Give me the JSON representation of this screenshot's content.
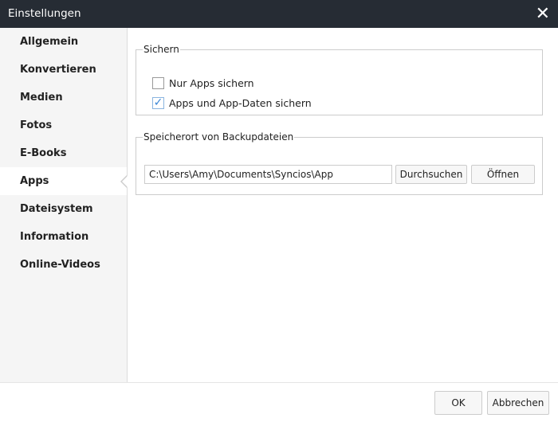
{
  "window": {
    "title": "Einstellungen",
    "close_icon": "close-icon"
  },
  "sidebar": {
    "items": [
      {
        "label": "Allgemein"
      },
      {
        "label": "Konvertieren"
      },
      {
        "label": "Medien"
      },
      {
        "label": "Fotos"
      },
      {
        "label": "E-Books"
      },
      {
        "label": "Apps",
        "selected": true
      },
      {
        "label": "Dateisystem"
      },
      {
        "label": "Information"
      },
      {
        "label": "Online-Videos"
      }
    ]
  },
  "backup": {
    "legend": "Sichern",
    "options": [
      {
        "label": "Nur Apps sichern",
        "checked": false
      },
      {
        "label": "Apps und App-Daten sichern",
        "checked": true
      }
    ]
  },
  "location": {
    "legend": "Speicherort von Backupdateien",
    "path": "C:\\Users\\Amy\\Documents\\Syncios\\App",
    "browse": "Durchsuchen",
    "open": "Öffnen"
  },
  "footer": {
    "ok": "OK",
    "cancel": "Abbrechen"
  },
  "colors": {
    "titlebar": "#262c34",
    "check": "#3a86d6"
  }
}
